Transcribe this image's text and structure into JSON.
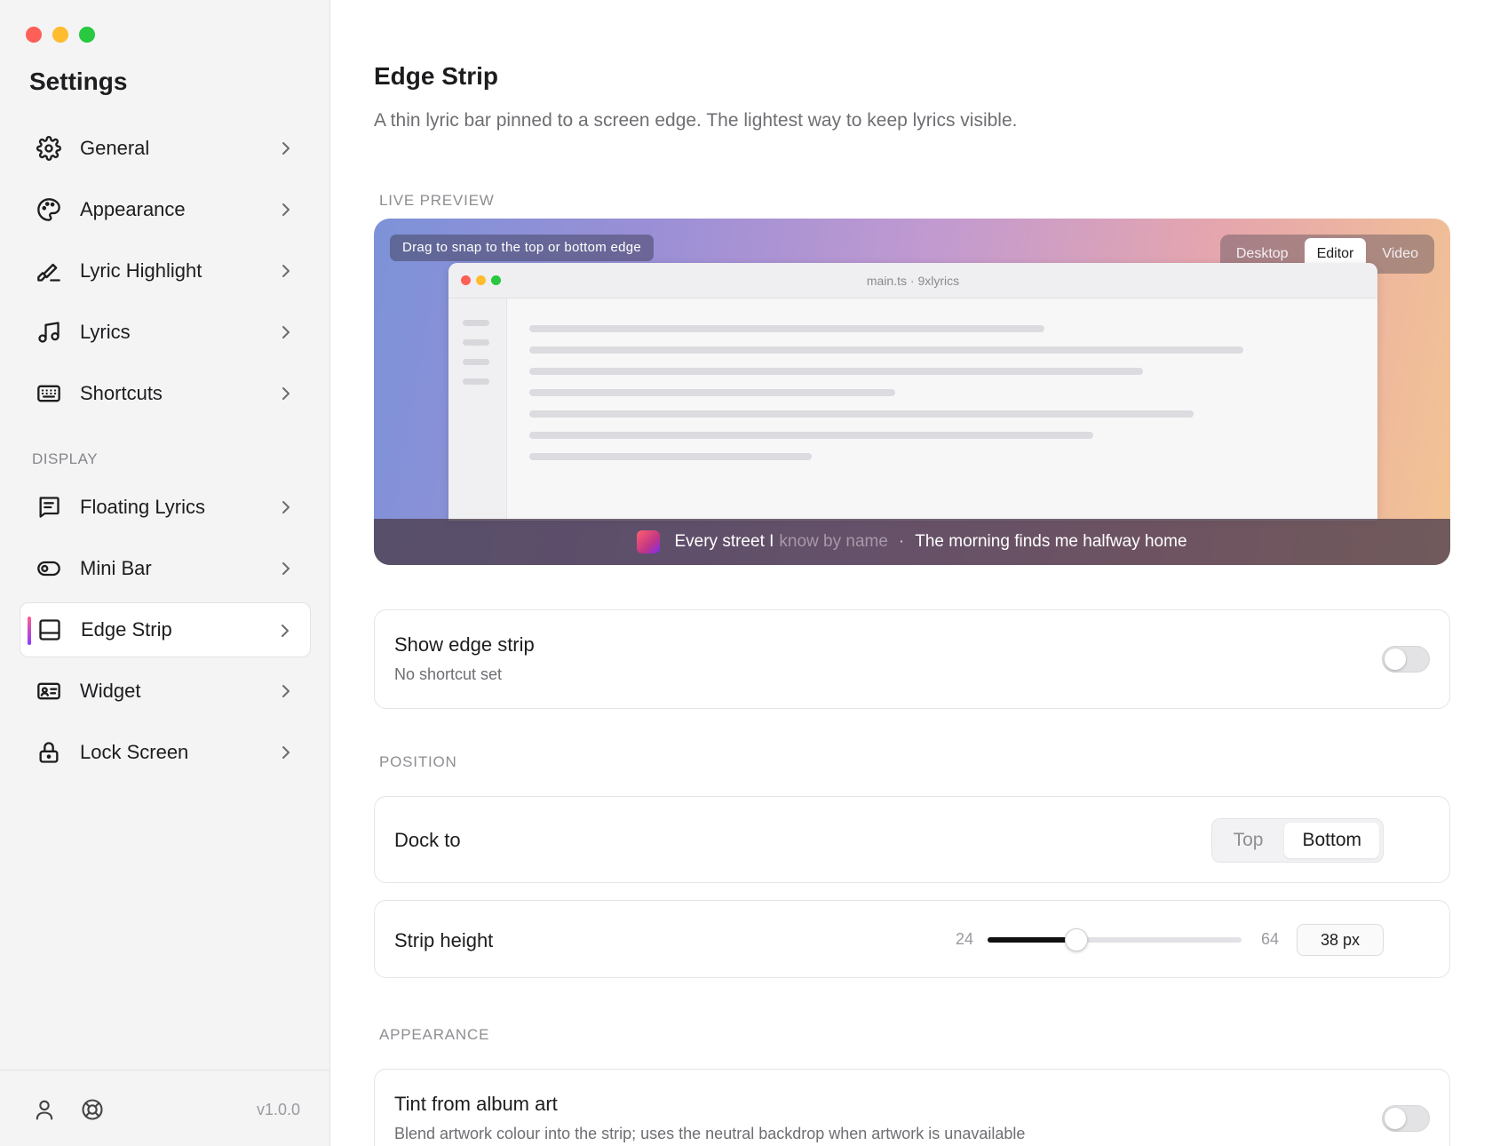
{
  "window": {
    "traffic_lights": [
      "#fe5f57",
      "#febc2e",
      "#28c840"
    ]
  },
  "sidebar": {
    "title": "Settings",
    "section_display": "DISPLAY",
    "items": [
      {
        "label": "General",
        "icon": "gear-icon"
      },
      {
        "label": "Appearance",
        "icon": "palette-icon"
      },
      {
        "label": "Lyric Highlight",
        "icon": "highlighter-icon"
      },
      {
        "label": "Lyrics",
        "icon": "music-note-icon"
      },
      {
        "label": "Shortcuts",
        "icon": "keyboard-icon"
      }
    ],
    "display_items": [
      {
        "label": "Floating Lyrics",
        "icon": "message-square-icon"
      },
      {
        "label": "Mini Bar",
        "icon": "toggle-pill-icon"
      },
      {
        "label": "Edge Strip",
        "icon": "panel-bottom-icon",
        "active": true
      },
      {
        "label": "Widget",
        "icon": "id-card-icon"
      },
      {
        "label": "Lock Screen",
        "icon": "lock-icon"
      }
    ],
    "footer": {
      "version": "v1.0.0",
      "icons": [
        "user-icon",
        "lifebuoy-icon"
      ]
    }
  },
  "page": {
    "title": "Edge Strip",
    "description": "A thin lyric bar pinned to a screen edge. The lightest way to keep lyrics visible."
  },
  "preview": {
    "section_label": "LIVE PREVIEW",
    "hint": "Drag to snap to the top or bottom edge",
    "modes": [
      "Desktop",
      "Editor",
      "Video"
    ],
    "selected_mode": "Editor",
    "window_file": "main.ts · 9xlyrics",
    "lyric_sung": "Every street I",
    "lyric_unsung": "know by name",
    "lyric_separator": "·",
    "lyric_next": "The morning finds me halfway home"
  },
  "show_strip": {
    "title": "Show edge strip",
    "subtitle": "No shortcut set",
    "enabled": false
  },
  "position": {
    "section_label": "POSITION",
    "dock_label": "Dock to",
    "dock_options": [
      "Top",
      "Bottom"
    ],
    "dock_selected": "Bottom",
    "height_label": "Strip height",
    "height_min": "24",
    "height_max": "64",
    "height_value": 38,
    "height_display": "38 px"
  },
  "appearance": {
    "section_label": "APPEARANCE",
    "tint_title": "Tint from album art",
    "tint_subtitle": "Blend artwork colour into the strip; uses the neutral backdrop when artwork is unavailable",
    "tint_enabled": false
  }
}
